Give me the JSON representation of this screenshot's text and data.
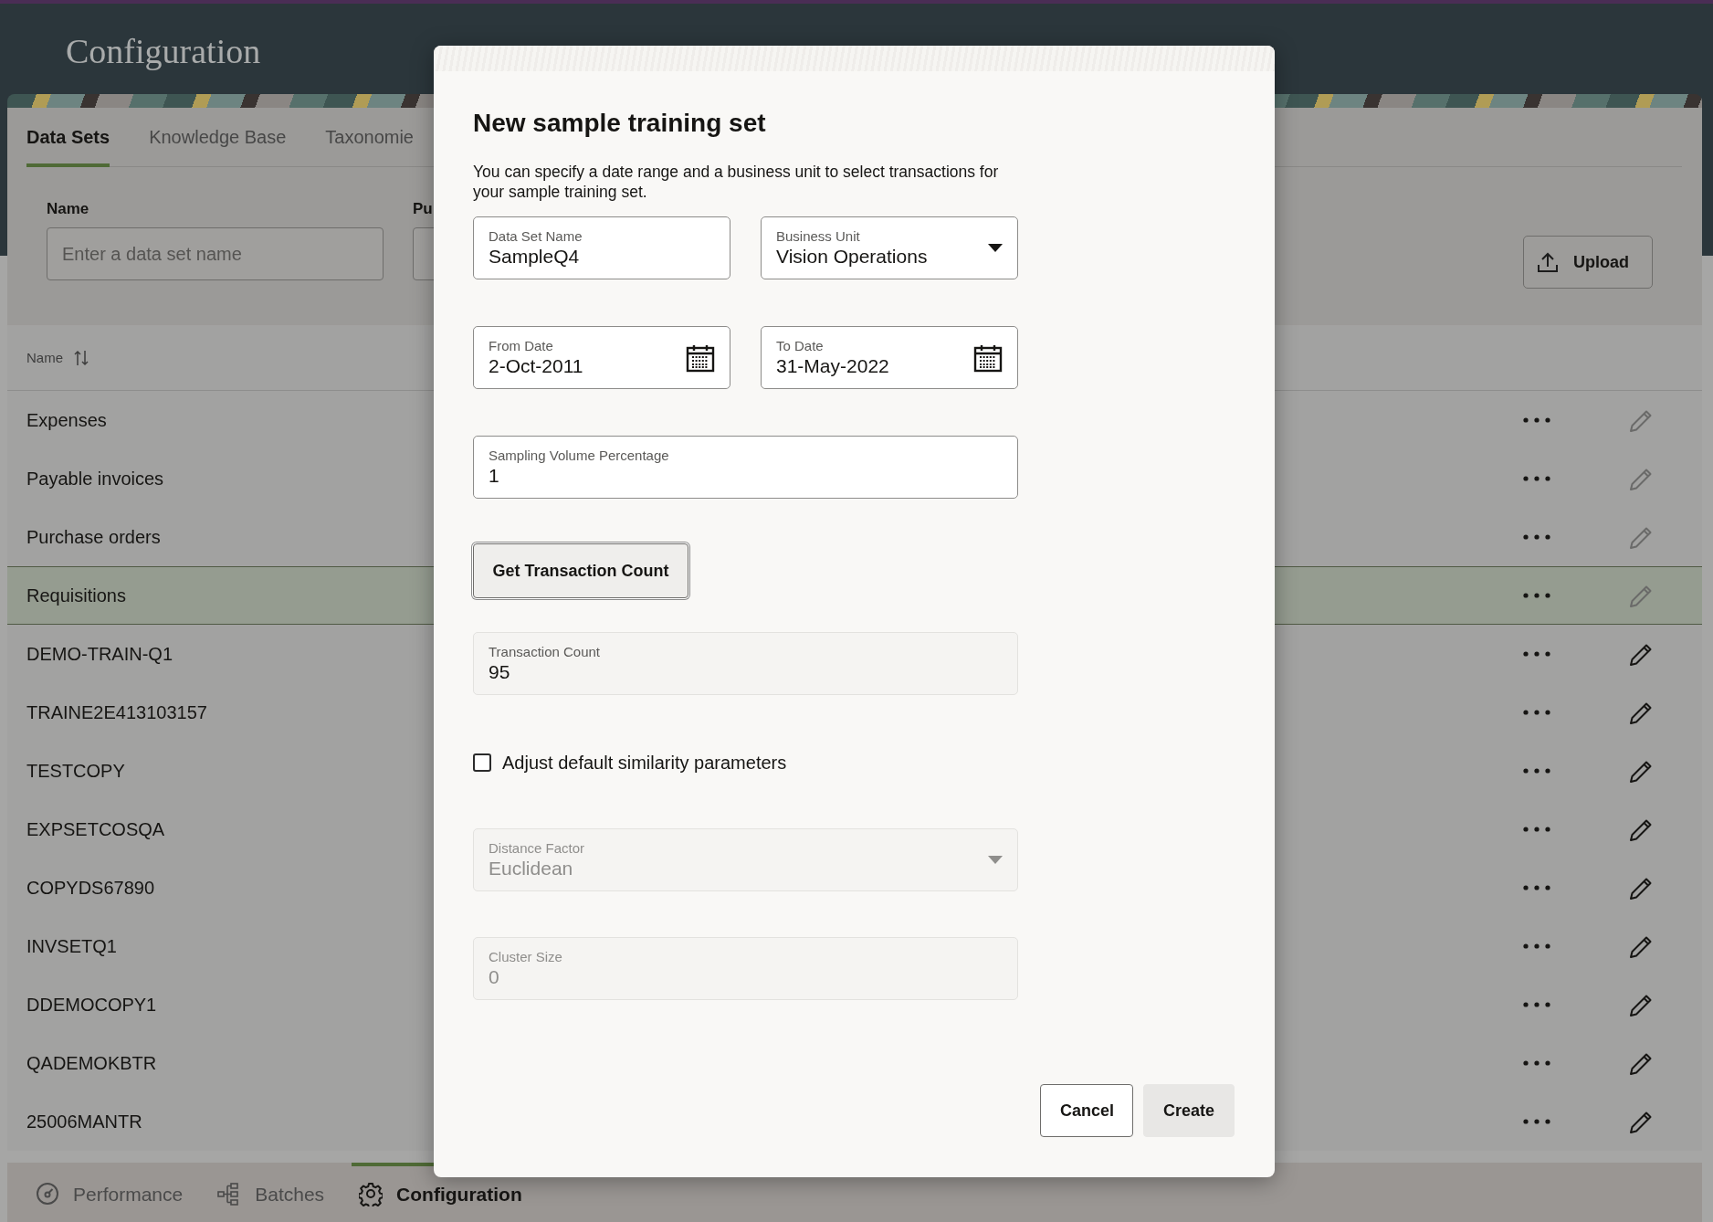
{
  "header": {
    "title": "Configuration"
  },
  "tabs": [
    {
      "label": "Data Sets",
      "selected": true
    },
    {
      "label": "Knowledge Base",
      "selected": false
    },
    {
      "label": "Taxonomie",
      "selected": false
    }
  ],
  "filters": [
    {
      "label": "Name",
      "placeholder": "Enter a data set name"
    },
    {
      "label": "Pu"
    }
  ],
  "upload_button": {
    "label": "Upload"
  },
  "table": {
    "columns": [
      {
        "label": "Name"
      }
    ],
    "rows": [
      {
        "name": "Expenses",
        "selected": false,
        "editable": false
      },
      {
        "name": "Payable invoices",
        "selected": false,
        "editable": false
      },
      {
        "name": "Purchase orders",
        "selected": false,
        "editable": false
      },
      {
        "name": "Requisitions",
        "selected": true,
        "editable": false
      },
      {
        "name": "DEMO-TRAIN-Q1",
        "selected": false,
        "editable": true
      },
      {
        "name": "TRAINE2E413103157",
        "selected": false,
        "editable": true
      },
      {
        "name": "TESTCOPY",
        "selected": false,
        "editable": true
      },
      {
        "name": "EXPSETCOSQA",
        "selected": false,
        "editable": true
      },
      {
        "name": "COPYDS67890",
        "selected": false,
        "editable": true
      },
      {
        "name": "INVSETQ1",
        "selected": false,
        "editable": true
      },
      {
        "name": "DDEMOCOPY1",
        "selected": false,
        "editable": true
      },
      {
        "name": "QADEMOKBTR",
        "selected": false,
        "editable": true
      },
      {
        "name": "25006MANTR",
        "selected": false,
        "editable": true
      }
    ]
  },
  "bottom_nav": [
    {
      "label": "Performance",
      "selected": false
    },
    {
      "label": "Batches",
      "selected": false
    },
    {
      "label": "Configuration",
      "selected": true
    }
  ],
  "dialog": {
    "title": "New sample training set",
    "description": "You can specify a date range and a business unit to select transactions for your sample training set.",
    "data_set_name": {
      "label": "Data Set Name",
      "value": "SampleQ4"
    },
    "business_unit": {
      "label": "Business Unit",
      "value": "Vision Operations",
      "kind": "select"
    },
    "from_date": {
      "label": "From Date",
      "value": "2-Oct-2011",
      "kind": "date"
    },
    "to_date": {
      "label": "To Date",
      "value": "31-May-2022",
      "kind": "date"
    },
    "sampling_volume": {
      "label": "Sampling Volume Percentage",
      "value": "1"
    },
    "count_button": {
      "label": "Get Transaction Count"
    },
    "transaction_count": {
      "label": "Transaction Count",
      "value": "95",
      "readonly": true
    },
    "similarity_checkbox": {
      "label": "Adjust default similarity parameters",
      "checked": false
    },
    "distance_factor": {
      "label": "Distance Factor",
      "value": "Euclidean",
      "kind": "select",
      "disabled": true
    },
    "cluster_size": {
      "label": "Cluster Size",
      "value": "0",
      "disabled": true
    },
    "buttons": [
      {
        "label": "Cancel",
        "kind": "outline"
      },
      {
        "label": "Create",
        "kind": "filled"
      }
    ]
  }
}
